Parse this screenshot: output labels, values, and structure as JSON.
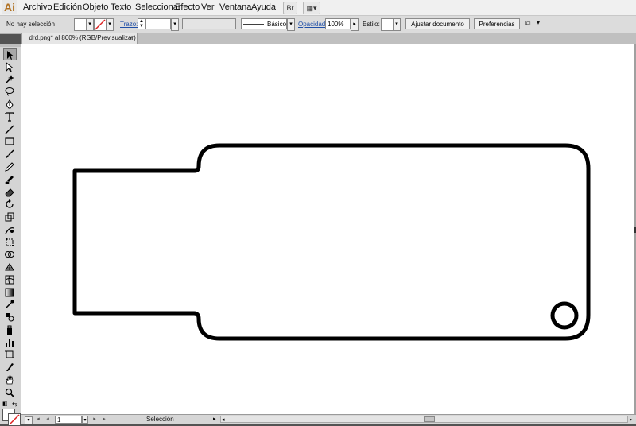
{
  "app": {
    "logo": "Ai"
  },
  "menu": {
    "items": [
      "Archivo",
      "Edición",
      "Objeto",
      "Texto",
      "Seleccionar",
      "Efecto",
      "Ver",
      "Ventana",
      "Ayuda"
    ],
    "bridge_icon": "bridge-icon",
    "arrange_icon": "arrange-documents-icon"
  },
  "control": {
    "selection_status": "No hay selección",
    "trazo_label": "Trazo:",
    "brush_preset": "Básico",
    "opacity_label": "Opacidad:",
    "opacity_value": "100%",
    "style_label": "Estilo:",
    "ajustar_button": "Ajustar documento",
    "preferencias_button": "Preferencias"
  },
  "document_tab": {
    "title": "_drd.png* al 800% (RGB/Previsualizar)",
    "close": "×"
  },
  "status": {
    "artboard_number": "1",
    "tool_name": "Selección"
  },
  "colors": {
    "canvas": "#ffffff",
    "artwork_stroke": "#000000",
    "ui_light": "#f0f0f0",
    "ui_panel": "#d4d4d4"
  },
  "tools": [
    {
      "name": "selection-tool-icon"
    },
    {
      "name": "direct-selection-tool-icon"
    },
    {
      "name": "magic-wand-tool-icon"
    },
    {
      "name": "lasso-tool-icon"
    },
    {
      "name": "pen-tool-icon"
    },
    {
      "name": "type-tool-icon"
    },
    {
      "name": "line-segment-tool-icon"
    },
    {
      "name": "rectangle-tool-icon"
    },
    {
      "name": "paintbrush-tool-icon"
    },
    {
      "name": "pencil-tool-icon"
    },
    {
      "name": "blob-brush-tool-icon"
    },
    {
      "name": "eraser-tool-icon"
    },
    {
      "name": "rotate-tool-icon"
    },
    {
      "name": "scale-tool-icon"
    },
    {
      "name": "warp-tool-icon"
    },
    {
      "name": "free-transform-tool-icon"
    },
    {
      "name": "shape-builder-tool-icon"
    },
    {
      "name": "perspective-grid-tool-icon"
    },
    {
      "name": "mesh-tool-icon"
    },
    {
      "name": "gradient-tool-icon"
    },
    {
      "name": "eyedropper-tool-icon"
    },
    {
      "name": "blend-tool-icon"
    },
    {
      "name": "symbol-sprayer-tool-icon"
    },
    {
      "name": "column-graph-tool-icon"
    },
    {
      "name": "artboard-tool-icon"
    },
    {
      "name": "slice-tool-icon"
    },
    {
      "name": "hand-tool-icon"
    },
    {
      "name": "zoom-tool-icon"
    }
  ]
}
